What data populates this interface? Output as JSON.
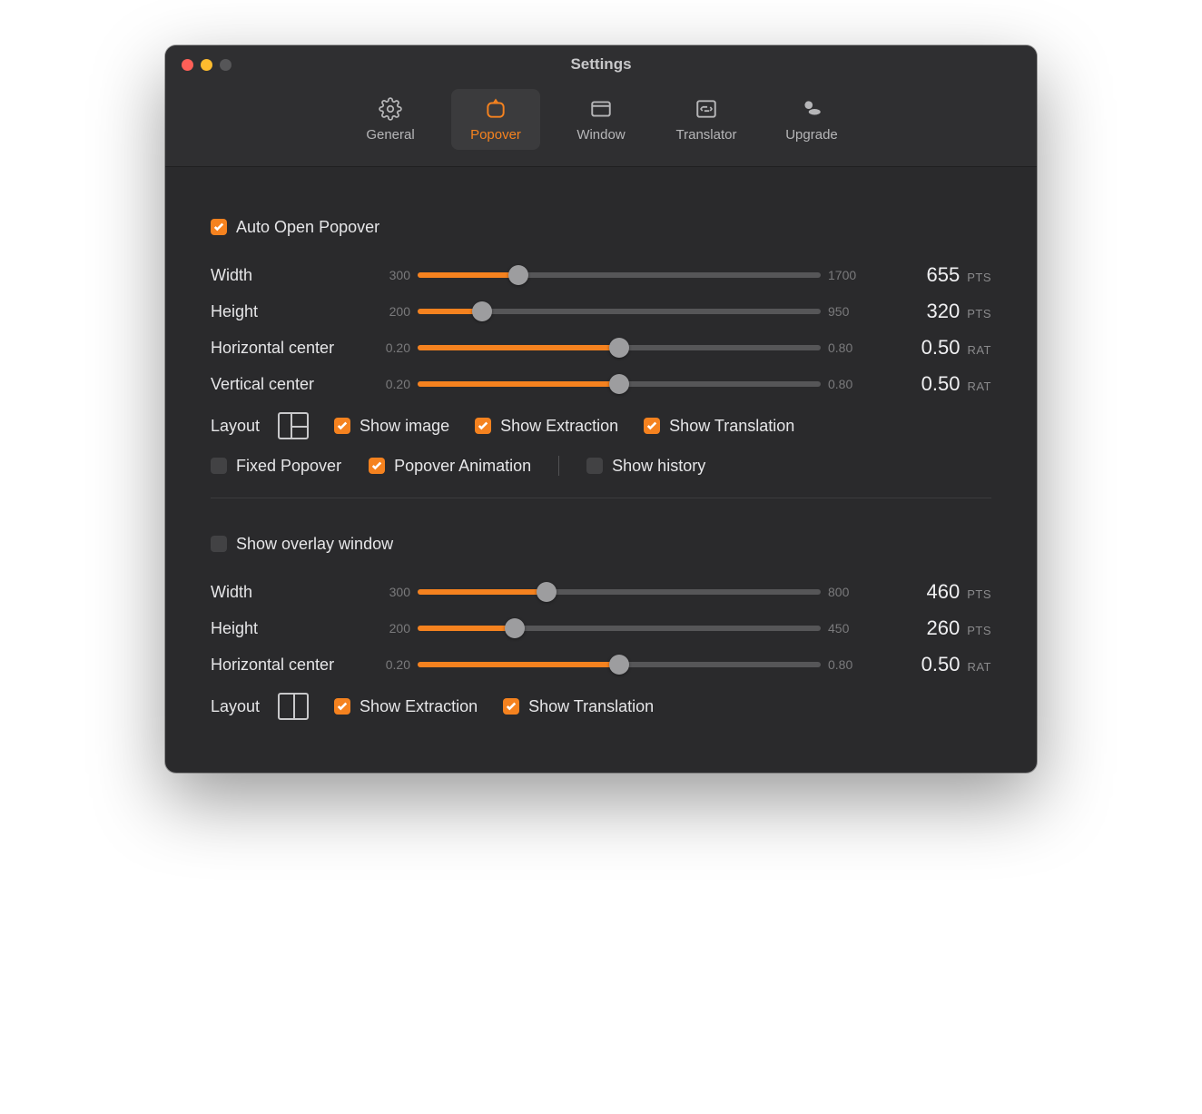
{
  "window": {
    "title": "Settings"
  },
  "tabs": {
    "general": "General",
    "popover": "Popover",
    "windowtab": "Window",
    "translator": "Translator",
    "upgrade": "Upgrade"
  },
  "units": {
    "pts": "PTS",
    "rat": "RAT"
  },
  "popover": {
    "auto_open": {
      "label": "Auto Open Popover",
      "checked": true
    },
    "sliders": {
      "width": {
        "label": "Width",
        "min": "300",
        "max": "1700",
        "value": "655",
        "unit": "PTS",
        "pct": 25
      },
      "height": {
        "label": "Height",
        "min": "200",
        "max": "950",
        "value": "320",
        "unit": "PTS",
        "pct": 16
      },
      "hcenter": {
        "label": "Horizontal center",
        "min": "0.20",
        "max": "0.80",
        "value": "0.50",
        "unit": "RAT",
        "pct": 50
      },
      "vcenter": {
        "label": "Vertical center",
        "min": "0.20",
        "max": "0.80",
        "value": "0.50",
        "unit": "RAT",
        "pct": 50
      }
    },
    "layout_label": "Layout",
    "show_image": {
      "label": "Show image",
      "checked": true
    },
    "show_extraction": {
      "label": "Show Extraction",
      "checked": true
    },
    "show_translation": {
      "label": "Show Translation",
      "checked": true
    },
    "fixed_popover": {
      "label": "Fixed Popover",
      "checked": false
    },
    "popover_animation": {
      "label": "Popover Animation",
      "checked": true
    },
    "show_history": {
      "label": "Show history",
      "checked": false
    }
  },
  "overlay": {
    "show_overlay": {
      "label": "Show overlay window",
      "checked": false
    },
    "sliders": {
      "width": {
        "label": "Width",
        "min": "300",
        "max": "800",
        "value": "460",
        "unit": "PTS",
        "pct": 32
      },
      "height": {
        "label": "Height",
        "min": "200",
        "max": "450",
        "value": "260",
        "unit": "PTS",
        "pct": 24
      },
      "hcenter": {
        "label": "Horizontal center",
        "min": "0.20",
        "max": "0.80",
        "value": "0.50",
        "unit": "RAT",
        "pct": 50
      }
    },
    "layout_label": "Layout",
    "show_extraction": {
      "label": "Show Extraction",
      "checked": true
    },
    "show_translation": {
      "label": "Show Translation",
      "checked": true
    }
  }
}
